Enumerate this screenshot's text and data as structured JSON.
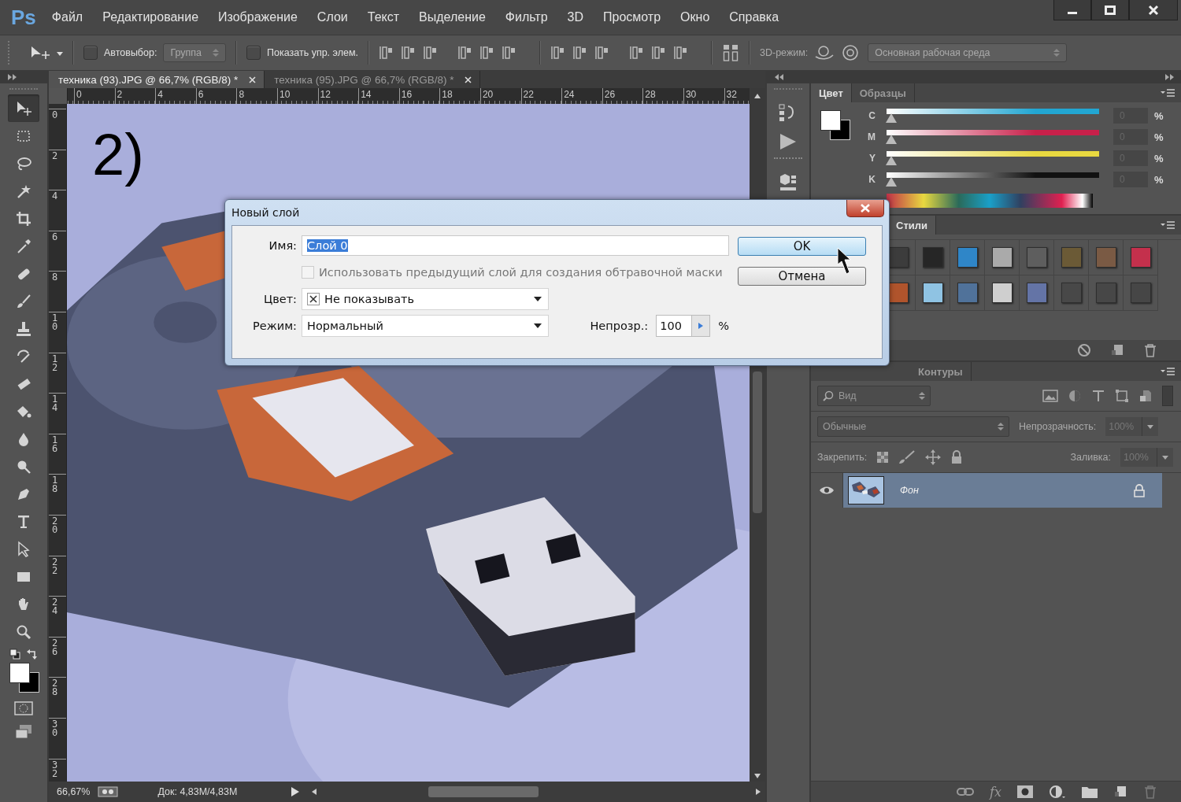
{
  "app": {
    "logo": "Ps"
  },
  "menu": [
    "Файл",
    "Редактирование",
    "Изображение",
    "Слои",
    "Текст",
    "Выделение",
    "Фильтр",
    "3D",
    "Просмотр",
    "Окно",
    "Справка"
  ],
  "options_bar": {
    "auto_select": {
      "label": "Автовыбор:",
      "checked": false
    },
    "auto_select_mode": "Группа",
    "show_transform": {
      "label": "Показать упр. элем.",
      "checked": false
    },
    "mode_3d_label": "3D-режим:",
    "workspace": "Основная рабочая среда"
  },
  "tools": [
    {
      "kind": "move",
      "selected": true
    },
    {
      "kind": "marquee",
      "selected": false
    },
    {
      "kind": "lasso",
      "selected": false
    },
    {
      "kind": "wand",
      "selected": false
    },
    {
      "kind": "crop",
      "selected": false
    },
    {
      "kind": "eyedropper",
      "selected": false
    },
    {
      "kind": "healing",
      "selected": false
    },
    {
      "kind": "brush",
      "selected": false
    },
    {
      "kind": "stamp",
      "selected": false
    },
    {
      "kind": "history-brush",
      "selected": false
    },
    {
      "kind": "eraser",
      "selected": false
    },
    {
      "kind": "bucket",
      "selected": false
    },
    {
      "kind": "blur",
      "selected": false
    },
    {
      "kind": "dodge",
      "selected": false
    },
    {
      "kind": "pen",
      "selected": false
    },
    {
      "kind": "type",
      "selected": false
    },
    {
      "kind": "path-select",
      "selected": false
    },
    {
      "kind": "rectangle",
      "selected": false
    },
    {
      "kind": "hand",
      "selected": false
    },
    {
      "kind": "zoom",
      "selected": false
    }
  ],
  "documents": [
    {
      "title": "техника (93).JPG @ 66,7% (RGB/8) *",
      "selected": true
    },
    {
      "title": "техника (95).JPG @ 66,7% (RGB/8) *",
      "selected": false
    }
  ],
  "rulers": {
    "horizontal": [
      "0",
      "2",
      "4",
      "6",
      "8",
      "10",
      "12",
      "14",
      "16",
      "18",
      "20",
      "22",
      "24",
      "26",
      "28",
      "30",
      "32"
    ],
    "vertical": [
      "0",
      "2",
      "4",
      "6",
      "8",
      "10",
      "12",
      "14",
      "16",
      "18",
      "20",
      "22",
      "24",
      "26",
      "28",
      "30",
      "32"
    ]
  },
  "canvas": {
    "annotation": "2)"
  },
  "status_bar": {
    "zoom": "66,67%",
    "doc_info": "Док: 4,83M/4,83M"
  },
  "dialog": {
    "title": "Новый слой",
    "name_label": "Имя:",
    "name_value": "Слой 0",
    "clip_option": {
      "label": "Использовать предыдущий слой для создания обтравочной маски",
      "checked": false,
      "disabled": true
    },
    "color_label": "Цвет:",
    "color_value": "Не показывать",
    "mode_label": "Режим:",
    "mode_value": "Нормальный",
    "opacity_label": "Непрозр.:",
    "opacity_value": "100",
    "opacity_unit": "%",
    "buttons": [
      {
        "label": "OK",
        "default": true
      },
      {
        "label": "Отмена",
        "default": false
      }
    ]
  },
  "color_panel": {
    "tabs": [
      {
        "label": "Цвет",
        "selected": true
      },
      {
        "label": "Образцы",
        "selected": false
      }
    ],
    "channels": [
      {
        "name": "C",
        "level": 0,
        "value": "0",
        "unit": "%",
        "color": "#22a6d2"
      },
      {
        "name": "M",
        "level": 0,
        "value": "0",
        "unit": "%",
        "color": "#c8204a"
      },
      {
        "name": "Y",
        "level": 0,
        "value": "0",
        "unit": "%",
        "color": "#e8d840"
      },
      {
        "name": "K",
        "level": 0,
        "value": "0",
        "unit": "%",
        "color": "#111111"
      }
    ]
  },
  "styles_panel": {
    "tabs": [
      {
        "label": "Стили",
        "selected": true
      }
    ],
    "swatches": [
      {
        "color": "#3c3c3c"
      },
      {
        "color": "#262626"
      },
      {
        "color": "#2f86c8"
      },
      {
        "color": "#aaaaaa"
      },
      {
        "color": "#5e5e5e"
      },
      {
        "color": "#6b5a36"
      },
      {
        "color": "#7a5a44"
      },
      {
        "color": "#c4304c"
      },
      {
        "color": "#b0542c"
      },
      {
        "color": "#8fc3e3"
      },
      {
        "color": "#50729a"
      },
      {
        "color": "#cfcfcf"
      },
      {
        "color": "#6474a6"
      },
      {
        "color": "#484848"
      },
      {
        "color": "#474747"
      },
      {
        "color": "#464646"
      }
    ]
  },
  "layers_panel": {
    "tabs": [
      {
        "label": "Контуры",
        "selected": false
      }
    ],
    "filter": "Вид",
    "blend_mode": "Обычные",
    "opacity_label": "Непрозрачность:",
    "opacity": "100%",
    "lock_label": "Закрепить:",
    "fill_label": "Заливка:",
    "fill": "100%",
    "effects_button": "fx",
    "layers": [
      {
        "name": "Фон",
        "visible": true,
        "selected": true,
        "locked": true
      }
    ]
  }
}
